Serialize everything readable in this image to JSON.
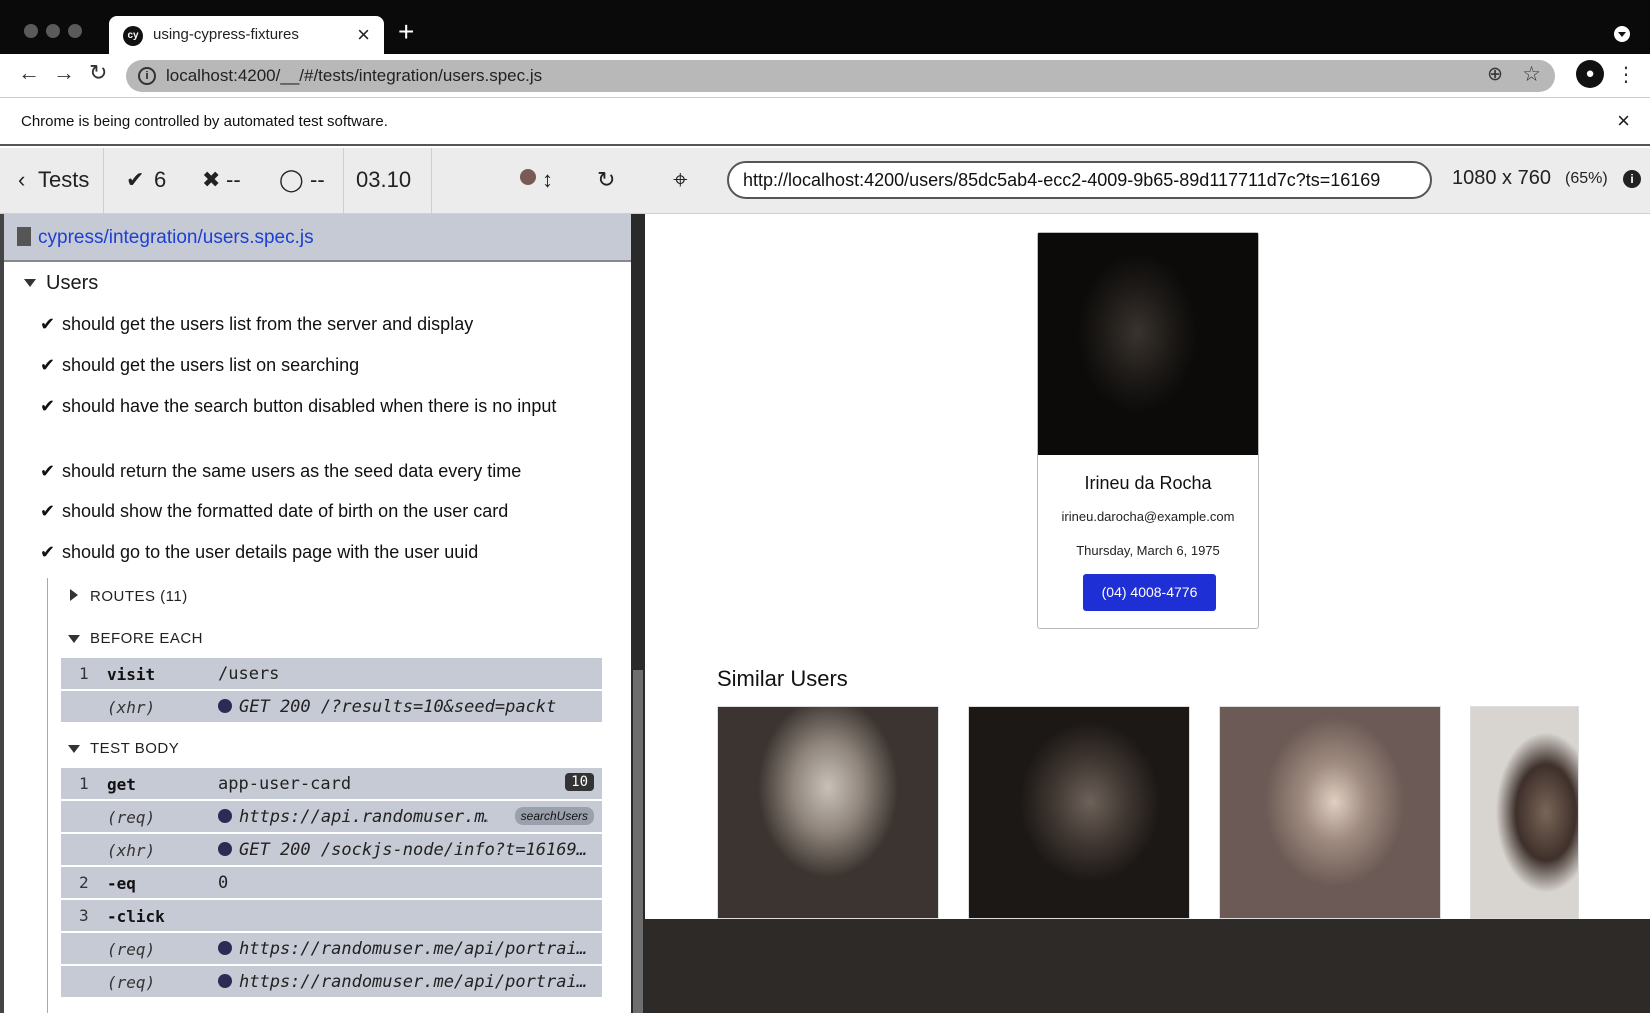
{
  "browser": {
    "tab_title": "using-cypress-fixtures",
    "tab_close": "×",
    "new_tab": "+",
    "favicon_text": "cy",
    "address": "localhost:4200/__/#/tests/integration/users.spec.js",
    "infobar_message": "Chrome is being controlled by automated test software.",
    "infobar_close": "×"
  },
  "reporter": {
    "back_label": "Tests",
    "passed_count": "6",
    "failed_count": "--",
    "pending_count": "--",
    "duration": "03.10",
    "spec_path": "cypress/integration/users.spec.js",
    "suite_title": "Users",
    "tests": [
      "should get the users list from the server and display",
      "should get the users list on searching",
      "should have the search button disabled when there is no input",
      "should return the same users as the seed data every time",
      "should show the formatted date of birth on the user card",
      "should go to the user details page with the user uuid"
    ],
    "routes_label": "ROUTES (11)",
    "before_each_label": "BEFORE EACH",
    "test_body_label": "TEST BODY",
    "before_each_commands": [
      {
        "num": "1",
        "name": "visit",
        "message": "/users"
      },
      {
        "num": "",
        "name": "(xhr)",
        "message": "GET 200 /?results=10&seed=packt"
      }
    ],
    "test_body_commands": [
      {
        "num": "1",
        "name": "get",
        "message": "app-user-card",
        "badge": "10"
      },
      {
        "num": "",
        "name": "(req)",
        "message": "https://api.randomuser.m…",
        "alias": "searchUsers"
      },
      {
        "num": "",
        "name": "(xhr)",
        "message": "GET 200 /sockjs-node/info?t=16169…"
      },
      {
        "num": "2",
        "name": "-eq",
        "message": "0"
      },
      {
        "num": "3",
        "name": "-click",
        "message": ""
      },
      {
        "num": "",
        "name": "(req)",
        "message": "https://randomuser.me/api/portrai…"
      },
      {
        "num": "",
        "name": "(req)",
        "message": "https://randomuser.me/api/portrai…"
      }
    ]
  },
  "runner": {
    "aut_url": "http://localhost:4200/users/85dc5ab4-ecc2-4009-9b65-89d117711d7c?ts=16169",
    "viewport": "1080 x 760",
    "scale": "(65%)"
  },
  "app": {
    "user": {
      "name": "Irineu da Rocha",
      "email": "irineu.darocha@example.com",
      "dob": "Thursday, March 6, 1975",
      "phone": "(04) 4008-4776"
    },
    "similar_title": "Similar Users"
  },
  "colors": {
    "accent_blue": "#1f2fd6",
    "spec_link": "#1c3fd4",
    "command_bg": "#c6cad4"
  }
}
